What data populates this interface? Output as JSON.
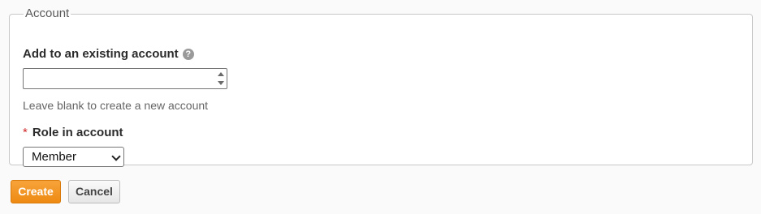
{
  "fieldset": {
    "legend": "Account"
  },
  "account_field": {
    "label": "Add to an existing account",
    "help_icon": "question-circle-icon",
    "value": "",
    "hint": "Leave blank to create a new account"
  },
  "role_field": {
    "required_mark": "*",
    "label": "Role in account",
    "selected": "Member"
  },
  "actions": {
    "create_label": "Create",
    "cancel_label": "Cancel"
  },
  "colors": {
    "primary_button": "#ee8a12",
    "required": "#d02a2a"
  }
}
